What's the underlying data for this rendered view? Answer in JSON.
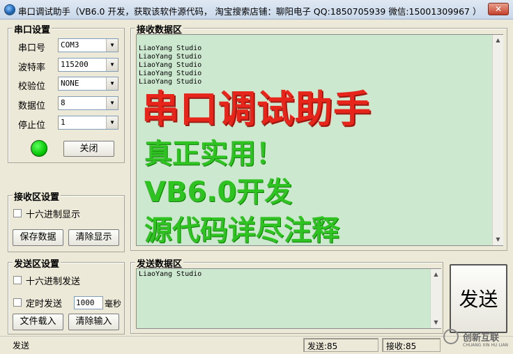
{
  "window": {
    "title": "串口调试助手（VB6.0 开发，获取该软件源代码， 淘宝搜索店铺：聊阳电子 QQ:1850705939 微信:15001309967 ）",
    "close_label": "✕"
  },
  "serial_settings": {
    "group_title": "串口设置",
    "port_label": "串口号",
    "port_value": "COM3",
    "baud_label": "波特率",
    "baud_value": "115200",
    "parity_label": "校验位",
    "parity_value": "NONE",
    "databits_label": "数据位",
    "databits_value": "8",
    "stopbits_label": "停止位",
    "stopbits_value": "1",
    "status_color": "#08c808",
    "toggle_button": "关闭"
  },
  "receive_settings": {
    "group_title": "接收区设置",
    "hex_display_label": "十六进制显示",
    "save_button": "保存数据",
    "clear_button": "清除显示"
  },
  "send_settings": {
    "group_title": "发送区设置",
    "hex_send_label": "十六进制发送",
    "timed_send_label": "定时发送",
    "interval_value": "1000",
    "interval_unit": "毫秒",
    "load_file_button": "文件载入",
    "clear_input_button": "清除输入"
  },
  "receive_area": {
    "group_title": "接收数据区",
    "lines": [
      "LiaoYang Studio",
      "LiaoYang Studio",
      "LiaoYang Studio",
      "LiaoYang Studio",
      "LiaoYang Studio"
    ],
    "overlay": {
      "headline": "串口调试助手",
      "line1": "真正实用！",
      "line2": "VB6.0开发",
      "line3": "源代码详尽注释",
      "headline_color": "#e8251b",
      "line_color": "#2fc321"
    }
  },
  "send_area": {
    "group_title": "发送数据区",
    "content": "LiaoYang Studio",
    "send_button": "发送"
  },
  "statusbar": {
    "status_text": "发送",
    "sent_count": "发送:85",
    "received_count": "接收:85"
  },
  "watermark": {
    "brand": "创新互联",
    "sub": "CHUANG XIN HU LIAN"
  }
}
